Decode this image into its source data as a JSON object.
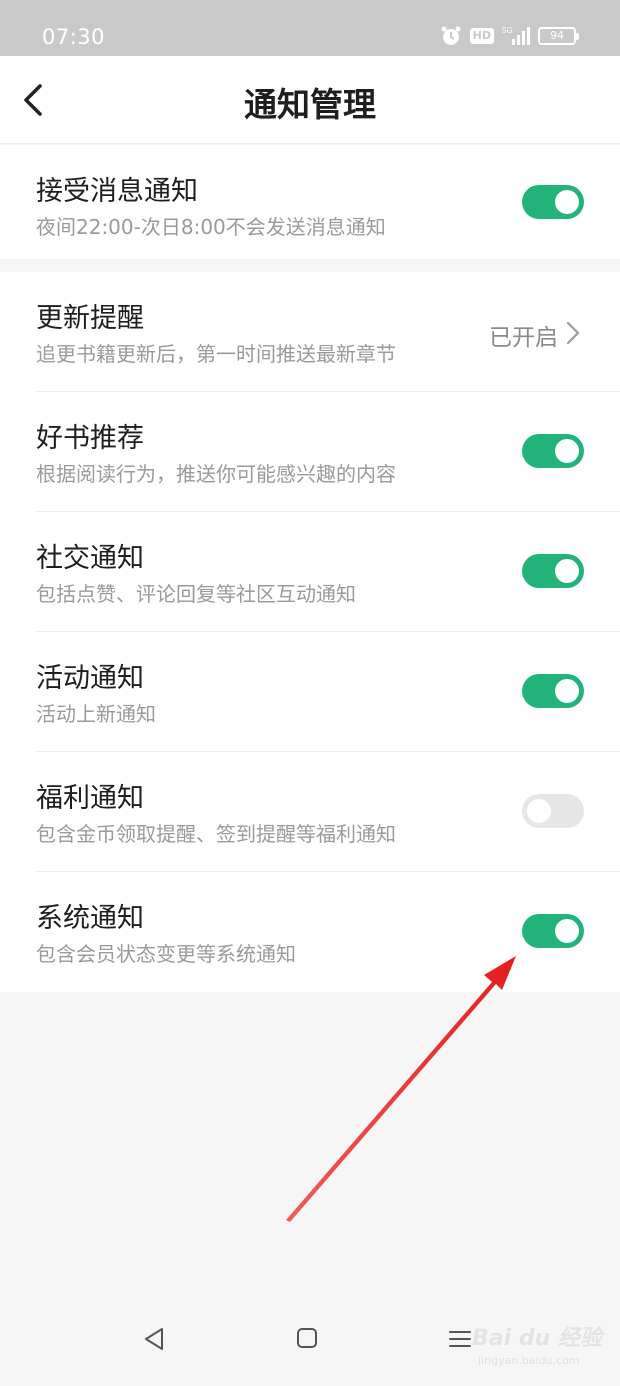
{
  "status_bar": {
    "time": "07:30",
    "hd": "HD",
    "network": "5G",
    "battery": "94",
    "icons": [
      "alarm-icon",
      "hd-icon",
      "signal-icon",
      "battery-icon"
    ]
  },
  "header": {
    "title": "通知管理",
    "back_icon": "chevron-left-icon"
  },
  "receive": {
    "title": "接受消息通知",
    "subtitle": "夜间22:00-次日8:00不会发送消息通知",
    "enabled": true
  },
  "settings": [
    {
      "title": "更新提醒",
      "subtitle": "追更书籍更新后，第一时间推送最新章节",
      "status": "已开启",
      "type": "link"
    },
    {
      "title": "好书推荐",
      "subtitle": "根据阅读行为，推送你可能感兴趣的内容",
      "enabled": true,
      "type": "toggle"
    },
    {
      "title": "社交通知",
      "subtitle": "包括点赞、评论回复等社区互动通知",
      "enabled": true,
      "type": "toggle"
    },
    {
      "title": "活动通知",
      "subtitle": "活动上新通知",
      "enabled": true,
      "type": "toggle"
    },
    {
      "title": "福利通知",
      "subtitle": "包含金币领取提醒、签到提醒等福利通知",
      "enabled": false,
      "type": "toggle"
    },
    {
      "title": "系统通知",
      "subtitle": "包含会员状态变更等系统通知",
      "enabled": true,
      "type": "toggle"
    }
  ],
  "colors": {
    "toggle_on": "#22b37b",
    "toggle_off": "#e6e6e6",
    "annotation_arrow": "#e8201f"
  },
  "bottom_nav": {
    "icons": [
      "back-triangle-icon",
      "home-square-icon",
      "menu-lines-icon"
    ],
    "watermark": "Bai du 经验",
    "watermark_url": "jingyan.baidu.com"
  }
}
